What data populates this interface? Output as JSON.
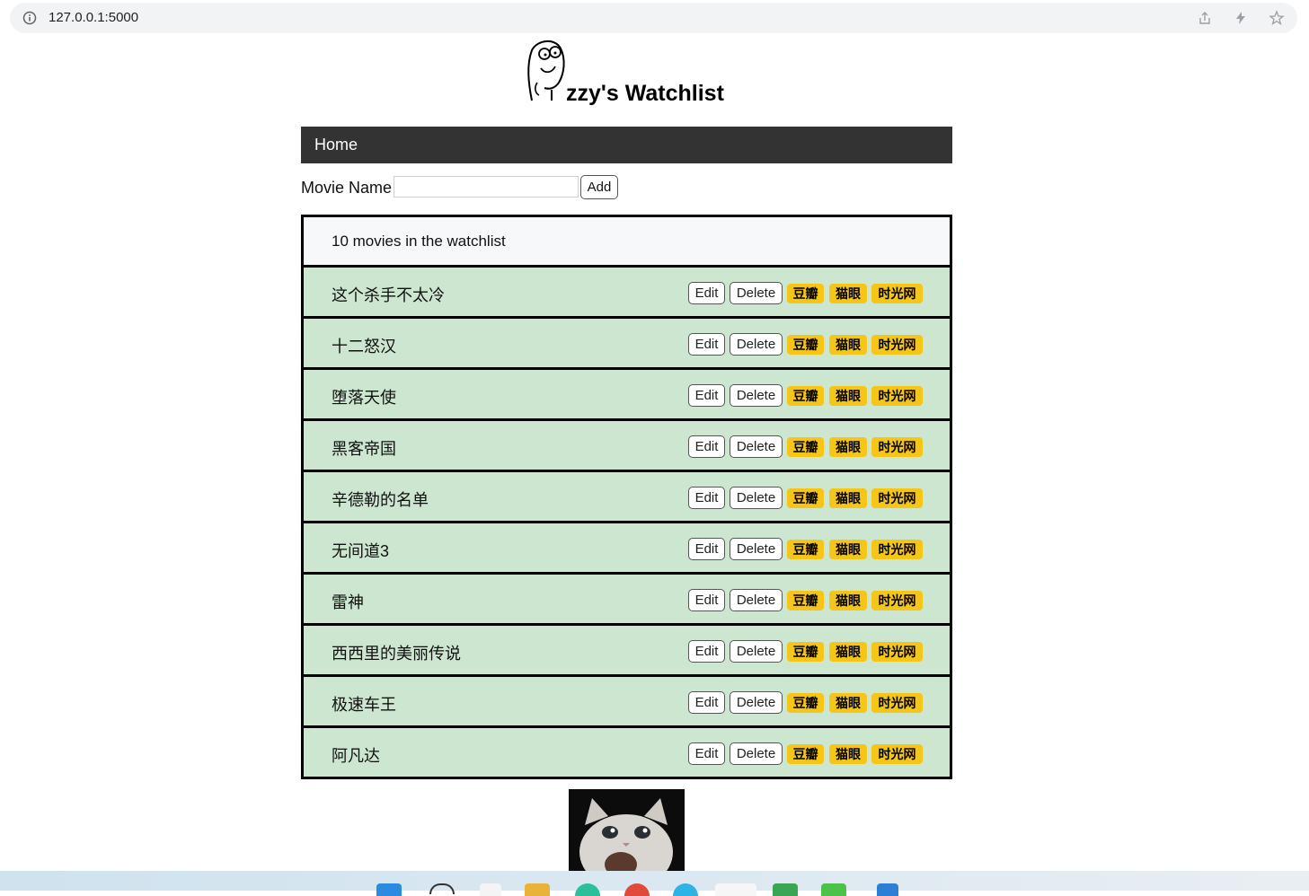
{
  "browser": {
    "url": "127.0.0.1:5000",
    "icons": [
      "info-icon",
      "share-icon",
      "lightning-icon",
      "star-icon"
    ]
  },
  "header": {
    "title": "zzy's Watchlist",
    "logo_icon": "meme-face-icon"
  },
  "nav": {
    "home_label": "Home"
  },
  "form": {
    "label": "Movie Name",
    "input_value": "",
    "add_label": "Add"
  },
  "watchlist": {
    "count_text": "10 movies in the watchlist",
    "edit_label": "Edit",
    "delete_label": "Delete",
    "tags": [
      "豆瓣",
      "猫眼",
      "时光网"
    ],
    "movies": [
      "这个杀手不太冷",
      "十二怒汉",
      "堕落天使",
      "黑客帝国",
      "辛德勒的名单",
      "无间道3",
      "雷神",
      "西西里的美丽传说",
      "极速车王",
      "阿凡达"
    ]
  },
  "footer": {
    "image_icon": "crying-cat-icon"
  },
  "colors": {
    "navbar_bg": "#333333",
    "row_bg": "#cde6cf",
    "tag_bg": "#f5c518",
    "count_bg": "#f7f8fa"
  }
}
